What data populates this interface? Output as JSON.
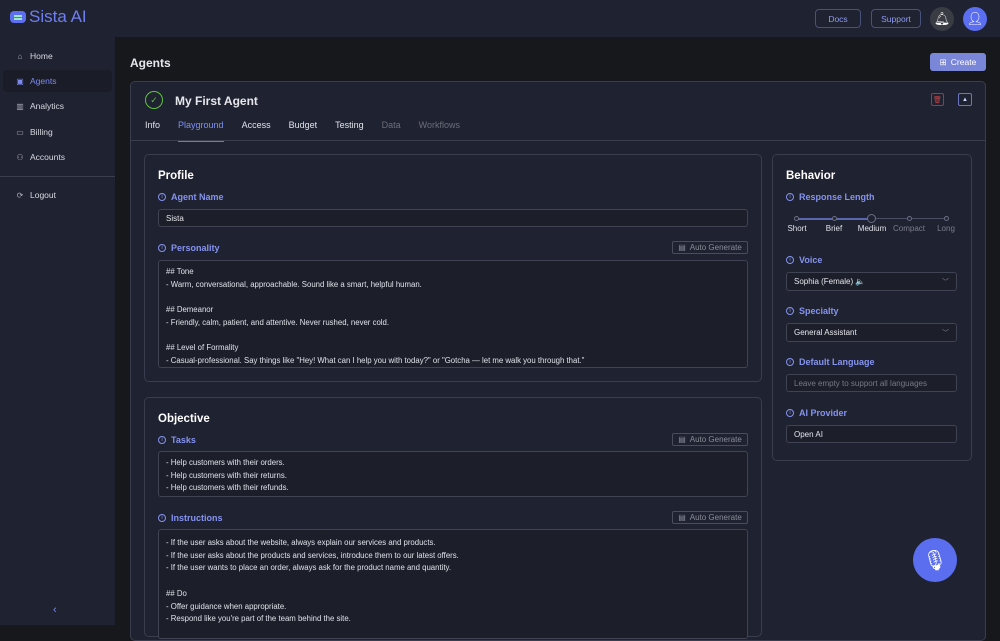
{
  "brand": {
    "name": "Sista AI"
  },
  "header": {
    "docs": "Docs",
    "support": "Support"
  },
  "sidebar": {
    "items": [
      {
        "label": "Home",
        "icon": "home-icon"
      },
      {
        "label": "Agents",
        "icon": "agent-icon"
      },
      {
        "label": "Analytics",
        "icon": "chart-icon"
      },
      {
        "label": "Billing",
        "icon": "billing-icon"
      },
      {
        "label": "Accounts",
        "icon": "accounts-icon"
      }
    ],
    "logout": "Logout"
  },
  "page": {
    "title": "Agents",
    "create": "Create"
  },
  "agent": {
    "name": "My First Agent",
    "tabs": [
      "Info",
      "Playground",
      "Access",
      "Budget",
      "Testing",
      "Data",
      "Workflows"
    ],
    "active_tab": "Playground"
  },
  "profile": {
    "title": "Profile",
    "agent_name_label": "Agent Name",
    "agent_name": "Sista",
    "personality_label": "Personality",
    "auto_generate": "Auto Generate",
    "personality": "## Tone\n- Warm, conversational, approachable. Sound like a smart, helpful human.\n\n## Demeanor\n- Friendly, calm, patient, and attentive. Never rushed, never cold.\n\n## Level of Formality\n- Casual-professional. Say things like \"Hey! What can I help you with today?\" or \"Gotcha — let me walk you through that.\""
  },
  "objective": {
    "title": "Objective",
    "tasks_label": "Tasks",
    "tasks": "- Help customers with their orders.\n- Help customers with their returns.\n- Help customers with their refunds.",
    "instructions_label": "Instructions",
    "instructions": "- If the user asks about the website, always explain our services and products.\n- If the user asks about the products and services, introduce them to our latest offers.\n- If the user wants to place an order, always ask for the product name and quantity.\n\n## Do\n- Offer guidance when appropriate.\n- Respond like you're part of the team behind the site."
  },
  "behavior": {
    "title": "Behavior",
    "response_length_label": "Response Length",
    "response_length_options": [
      "Short",
      "Brief",
      "Medium",
      "Compact",
      "Long"
    ],
    "response_length_selected": "Medium",
    "voice_label": "Voice",
    "voice": "Sophia (Female) 🔈",
    "specialty_label": "Specialty",
    "specialty": "General Assistant",
    "language_label": "Default Language",
    "language_placeholder": "Leave empty to support all languages",
    "provider_label": "AI Provider",
    "provider": "Open AI"
  },
  "colors": {
    "accent": "#7b87e0",
    "success": "#5fc23a",
    "danger": "#cc4444"
  }
}
